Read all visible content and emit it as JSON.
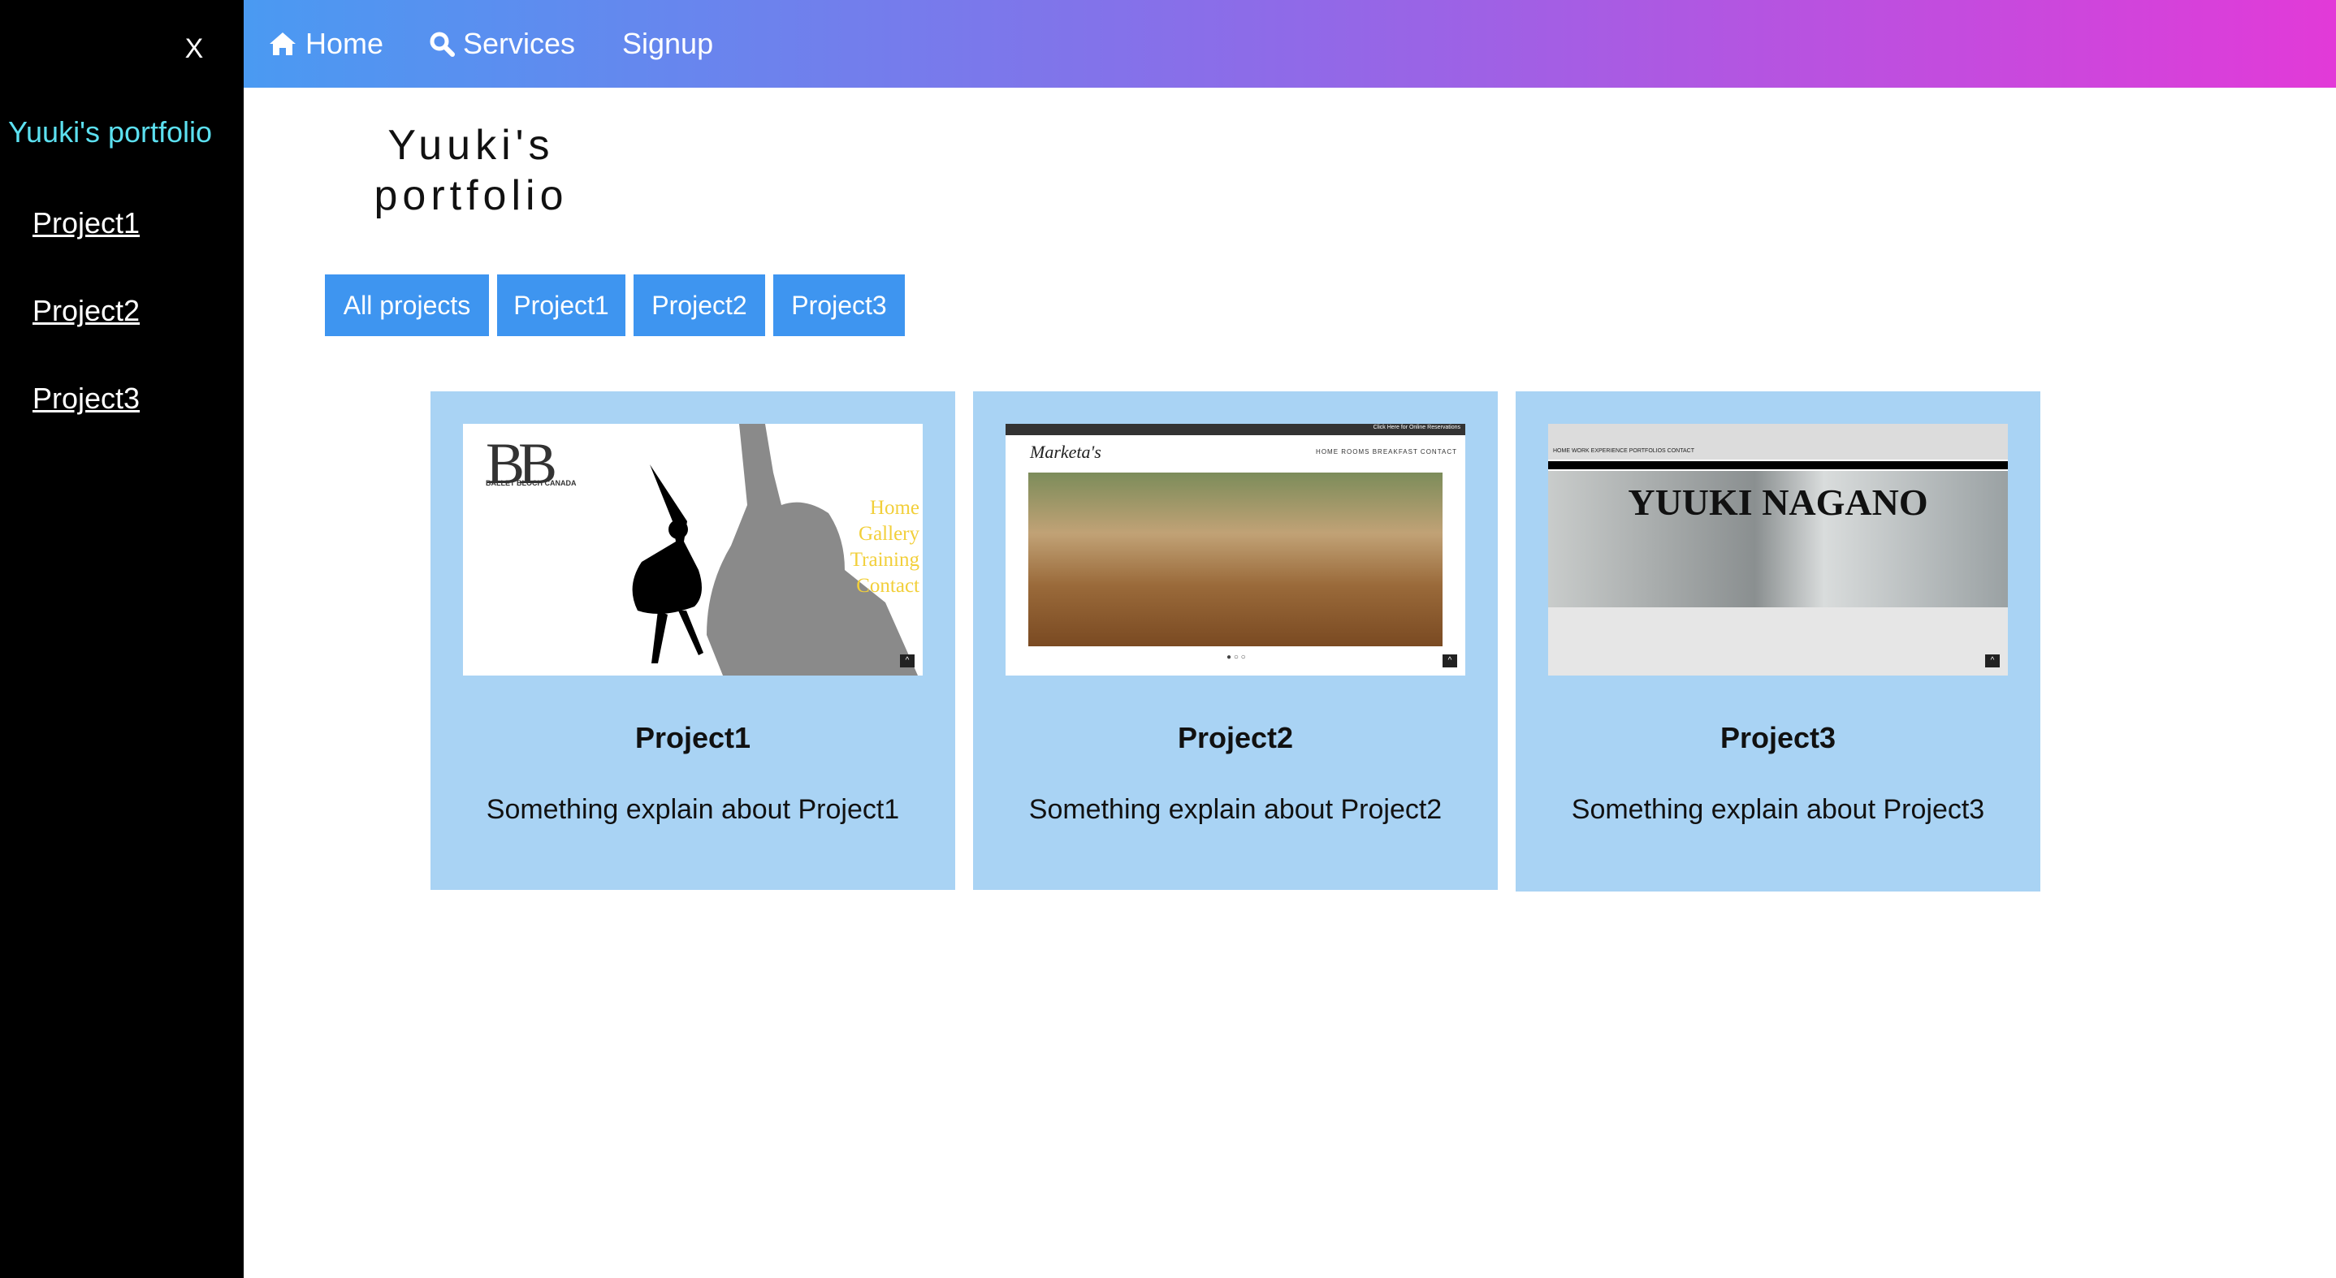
{
  "sidebar": {
    "close_label": "X",
    "brand": "Yuuki's portfolio",
    "links": [
      "Project1",
      "Project2",
      "Project3"
    ]
  },
  "topnav": {
    "items": [
      {
        "label": "Home",
        "icon": "home-icon"
      },
      {
        "label": "Services",
        "icon": "search-icon"
      },
      {
        "label": "Signup",
        "icon": ""
      }
    ]
  },
  "page": {
    "title_line1": "Yuuki's",
    "title_line2": "portfolio"
  },
  "filters": [
    "All projects",
    "Project1",
    "Project2",
    "Project3"
  ],
  "cards": [
    {
      "title": "Project1",
      "description": "Something explain about Project1",
      "thumb": {
        "logo": "BB",
        "subtitle": "BALLET BLOCH CANADA",
        "menu": [
          "Home",
          "Gallery",
          "Training",
          "Contact"
        ]
      }
    },
    {
      "title": "Project2",
      "description": "Something explain about Project2",
      "thumb": {
        "topbar_text": "Click Here for Online Reservations",
        "logo": "Marketa's",
        "menu": "HOME   ROOMS   BREAKFAST   CONTACT"
      }
    },
    {
      "title": "Project3",
      "description": "Something explain about Project3",
      "thumb": {
        "menu": "HOME   WORK EXPERIENCE   PORTFOLIOS   CONTACT",
        "name": "YUUKI NAGANO"
      }
    }
  ],
  "colors": {
    "sidebar_bg": "#000000",
    "brand_color": "#5ce0f0",
    "nav_gradient_start": "#4a9af2",
    "nav_gradient_end": "#e23ad8",
    "filter_button": "#3e95f0",
    "card_bg": "#a9d3f4",
    "thumb_menu_yellow": "#f2cf3a"
  }
}
